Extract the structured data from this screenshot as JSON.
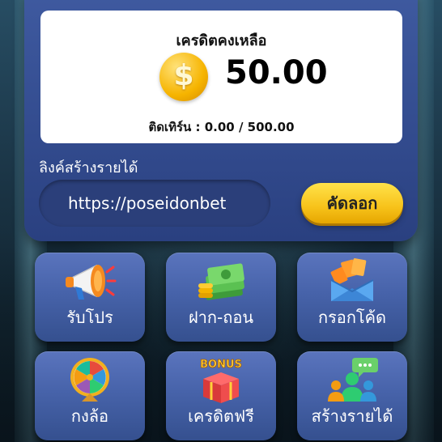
{
  "wallet": {
    "balance_title": "เครดิตคงเหลือ",
    "balance_amount": "50.00",
    "coin_symbol": "$",
    "turnover_label": "ติดเทิร์น :",
    "turnover_value": "0.00 / 500.00"
  },
  "referral": {
    "label": "ลิงค์สร้างรายได้",
    "link": "https://poseidonbet",
    "copy_label": "คัดลอก"
  },
  "menu": [
    {
      "label": "รับโปร",
      "icon": "megaphone-icon"
    },
    {
      "label": "ฝาก-ถอน",
      "icon": "money-stack-icon"
    },
    {
      "label": "กรอกโค้ด",
      "icon": "envelope-coupon-icon"
    },
    {
      "label": "กงล้อ",
      "icon": "prize-wheel-icon"
    },
    {
      "label": "เครดิตฟรี",
      "icon": "bonus-gift-box-icon"
    },
    {
      "label": "สร้างรายได้",
      "icon": "referral-people-icon"
    }
  ],
  "bonus_badge_text": "BONUS",
  "colors": {
    "panel": "#3f5aa0",
    "tile": "#4763aa",
    "accent_yellow": "#f7c21a",
    "coin": "#f6b400"
  }
}
